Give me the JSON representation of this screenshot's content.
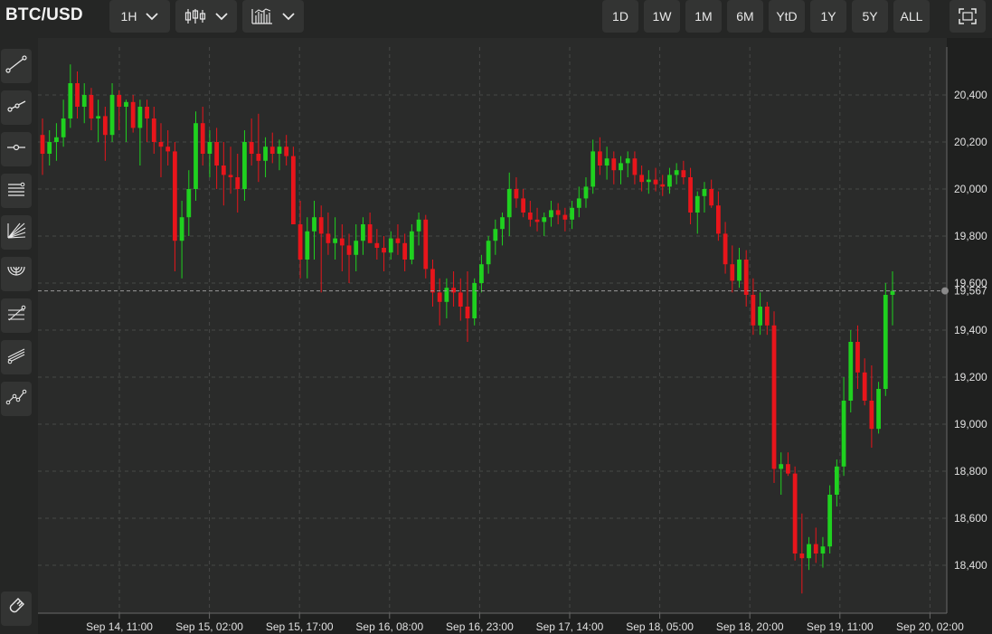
{
  "header": {
    "symbol": "BTC/USD",
    "interval": {
      "label": "1H"
    },
    "chart_type_icon": "candlestick-icon",
    "indicators_icon": "bar-chart-icon",
    "ranges": [
      "1D",
      "1W",
      "1M",
      "6M",
      "YtD",
      "1Y",
      "5Y",
      "ALL"
    ],
    "fullscreen_icon": "fullscreen-icon"
  },
  "drawing_tools": [
    {
      "name": "trend-line-icon"
    },
    {
      "name": "ray-icon"
    },
    {
      "name": "horizontal-line-icon"
    },
    {
      "name": "parallel-channel-icon"
    },
    {
      "name": "fib-fan-icon"
    },
    {
      "name": "fib-arc-icon"
    },
    {
      "name": "fib-retracement-icon"
    },
    {
      "name": "pitchfork-icon"
    },
    {
      "name": "path-icon"
    },
    {
      "name": "magnet-icon"
    }
  ],
  "colors": {
    "up": "#1fd11f",
    "down": "#e8151b",
    "background": "#2a2b2a",
    "grid": "#474847",
    "crosshair": "#9a9a9a"
  },
  "chart_data": {
    "type": "candlestick",
    "instrument": "BTC/USD",
    "interval": "1H",
    "y_axis": {
      "ticks": [
        "18,400",
        "18,600",
        "18,800",
        "19,000",
        "19,200",
        "19,400",
        "19,600",
        "19,800",
        "20,000",
        "20,200",
        "20,400"
      ],
      "ylim": [
        18250,
        20600
      ],
      "position": "right"
    },
    "x_axis": {
      "ticks": [
        "Sep 14, 11:00",
        "Sep 15, 02:00",
        "Sep 15, 17:00",
        "Sep 16, 08:00",
        "Sep 16, 23:00",
        "Sep 17, 14:00",
        "Sep 18, 05:00",
        "Sep 18, 20:00",
        "Sep 19, 11:00",
        "Sep 20, 02:00"
      ]
    },
    "last_price": {
      "value": 19567,
      "label": "19,567"
    },
    "grid": true,
    "candles": [
      [
        20230,
        20300,
        20060,
        20150
      ],
      [
        20150,
        20250,
        20100,
        20200
      ],
      [
        20200,
        20280,
        20120,
        20220
      ],
      [
        20220,
        20380,
        20180,
        20300
      ],
      [
        20300,
        20530,
        20260,
        20450
      ],
      [
        20450,
        20500,
        20300,
        20350
      ],
      [
        20350,
        20450,
        20280,
        20400
      ],
      [
        20400,
        20430,
        20250,
        20300
      ],
      [
        20300,
        20380,
        20200,
        20310
      ],
      [
        20310,
        20350,
        20120,
        20230
      ],
      [
        20230,
        20450,
        20200,
        20400
      ],
      [
        20400,
        20420,
        20250,
        20350
      ],
      [
        20350,
        20380,
        20200,
        20370
      ],
      [
        20370,
        20400,
        20240,
        20260
      ],
      [
        20260,
        20380,
        20100,
        20350
      ],
      [
        20350,
        20380,
        20200,
        20300
      ],
      [
        20300,
        20350,
        20150,
        20200
      ],
      [
        20200,
        20280,
        20050,
        20180
      ],
      [
        20180,
        20250,
        20100,
        20160
      ],
      [
        20160,
        20200,
        19650,
        19780
      ],
      [
        19780,
        19950,
        19620,
        19880
      ],
      [
        19880,
        20080,
        19800,
        20000
      ],
      [
        20000,
        20330,
        19950,
        20280
      ],
      [
        20280,
        20350,
        20100,
        20150
      ],
      [
        20150,
        20250,
        20050,
        20200
      ],
      [
        20200,
        20260,
        20000,
        20100
      ],
      [
        20100,
        20200,
        19930,
        20060
      ],
      [
        20060,
        20180,
        19980,
        20050
      ],
      [
        20050,
        20150,
        19900,
        20000
      ],
      [
        20000,
        20250,
        19950,
        20200
      ],
      [
        20200,
        20300,
        20100,
        20150
      ],
      [
        20150,
        20320,
        20030,
        20120
      ],
      [
        20120,
        20220,
        20050,
        20180
      ],
      [
        20180,
        20240,
        20110,
        20150
      ],
      [
        20150,
        20210,
        20080,
        20180
      ],
      [
        20180,
        20230,
        20100,
        20140
      ],
      [
        20140,
        20180,
        19900,
        19850
      ],
      [
        19850,
        19950,
        19620,
        19700
      ],
      [
        19700,
        19880,
        19620,
        19820
      ],
      [
        19820,
        19950,
        19700,
        19880
      ],
      [
        19880,
        19930,
        19560,
        19810
      ],
      [
        19810,
        19900,
        19720,
        19770
      ],
      [
        19770,
        19880,
        19700,
        19790
      ],
      [
        19790,
        19850,
        19650,
        19760
      ],
      [
        19760,
        19810,
        19600,
        19720
      ],
      [
        19720,
        19850,
        19650,
        19780
      ],
      [
        19780,
        19880,
        19720,
        19850
      ],
      [
        19850,
        19900,
        19800,
        19770
      ],
      [
        19770,
        19830,
        19700,
        19750
      ],
      [
        19750,
        19800,
        19650,
        19730
      ],
      [
        19730,
        19820,
        19700,
        19790
      ],
      [
        19790,
        19850,
        19720,
        19770
      ],
      [
        19770,
        19810,
        19650,
        19700
      ],
      [
        19700,
        19850,
        19680,
        19820
      ],
      [
        19820,
        19900,
        19760,
        19870
      ],
      [
        19870,
        19890,
        19620,
        19660
      ],
      [
        19660,
        19700,
        19500,
        19560
      ],
      [
        19560,
        19620,
        19420,
        19520
      ],
      [
        19520,
        19620,
        19450,
        19580
      ],
      [
        19580,
        19650,
        19500,
        19560
      ],
      [
        19560,
        19620,
        19440,
        19500
      ],
      [
        19500,
        19650,
        19350,
        19450
      ],
      [
        19450,
        19620,
        19420,
        19600
      ],
      [
        19600,
        19720,
        19560,
        19680
      ],
      [
        19680,
        19800,
        19640,
        19780
      ],
      [
        19780,
        19870,
        19720,
        19830
      ],
      [
        19830,
        19900,
        19760,
        19880
      ],
      [
        19880,
        20070,
        19800,
        20000
      ],
      [
        20000,
        20050,
        19920,
        19960
      ],
      [
        19960,
        20000,
        19880,
        19900
      ],
      [
        19900,
        19950,
        19840,
        19870
      ],
      [
        19870,
        19920,
        19820,
        19860
      ],
      [
        19860,
        19900,
        19800,
        19880
      ],
      [
        19880,
        19950,
        19840,
        19910
      ],
      [
        19910,
        19940,
        19850,
        19890
      ],
      [
        19890,
        19920,
        19820,
        19870
      ],
      [
        19870,
        19950,
        19830,
        19920
      ],
      [
        19920,
        20010,
        19880,
        19960
      ],
      [
        19960,
        20050,
        19920,
        20010
      ],
      [
        20010,
        20210,
        19980,
        20160
      ],
      [
        20160,
        20220,
        20060,
        20100
      ],
      [
        20100,
        20180,
        20040,
        20130
      ],
      [
        20130,
        20160,
        20020,
        20080
      ],
      [
        20080,
        20140,
        20020,
        20110
      ],
      [
        20110,
        20160,
        20050,
        20130
      ],
      [
        20130,
        20160,
        20020,
        20060
      ],
      [
        20060,
        20100,
        19990,
        20030
      ],
      [
        20030,
        20080,
        19980,
        20040
      ],
      [
        20040,
        20090,
        19990,
        20020
      ],
      [
        20020,
        20060,
        19970,
        20010
      ],
      [
        20010,
        20090,
        19980,
        20060
      ],
      [
        20060,
        20110,
        20020,
        20080
      ],
      [
        20080,
        20120,
        20020,
        20050
      ],
      [
        20050,
        20090,
        19850,
        19900
      ],
      [
        19900,
        19990,
        19810,
        19970
      ],
      [
        19970,
        20030,
        19900,
        20000
      ],
      [
        20000,
        20040,
        19920,
        19930
      ],
      [
        19930,
        19990,
        19780,
        19810
      ],
      [
        19810,
        19860,
        19640,
        19680
      ],
      [
        19680,
        19760,
        19560,
        19610
      ],
      [
        19610,
        19750,
        19580,
        19700
      ],
      [
        19700,
        19740,
        19500,
        19550
      ],
      [
        19550,
        19620,
        19380,
        19420
      ],
      [
        19420,
        19560,
        19380,
        19500
      ],
      [
        19500,
        19520,
        19380,
        19420
      ],
      [
        19420,
        19480,
        18750,
        18810
      ],
      [
        18810,
        18880,
        18700,
        18830
      ],
      [
        18830,
        18880,
        18780,
        18790
      ],
      [
        18790,
        18820,
        18420,
        18450
      ],
      [
        18450,
        18620,
        18280,
        18430
      ],
      [
        18430,
        18520,
        18380,
        18490
      ],
      [
        18490,
        18560,
        18410,
        18450
      ],
      [
        18450,
        18520,
        18390,
        18480
      ],
      [
        18480,
        18740,
        18450,
        18700
      ],
      [
        18700,
        18850,
        18650,
        18820
      ],
      [
        18820,
        19200,
        18780,
        19100
      ],
      [
        19100,
        19400,
        19050,
        19350
      ],
      [
        19350,
        19420,
        19150,
        19220
      ],
      [
        19220,
        19280,
        19080,
        19100
      ],
      [
        19100,
        19250,
        18900,
        18980
      ],
      [
        18980,
        19180,
        18960,
        19150
      ],
      [
        19150,
        19600,
        19120,
        19550
      ],
      [
        19550,
        19650,
        19420,
        19567
      ]
    ]
  }
}
